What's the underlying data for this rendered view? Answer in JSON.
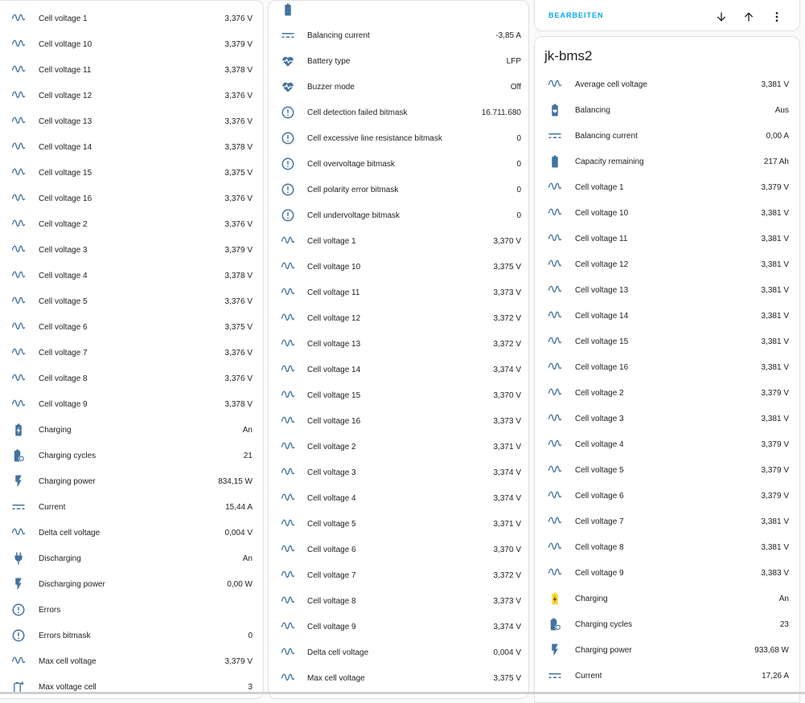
{
  "colors": {
    "icon": "#44739e",
    "charging_active": "#fdd835",
    "accent": "#03a9f4"
  },
  "column1": [
    {
      "icon": "sine-wave-icon",
      "name": "Cell voltage 1",
      "value": "3,376 V"
    },
    {
      "icon": "sine-wave-icon",
      "name": "Cell voltage 10",
      "value": "3,379 V"
    },
    {
      "icon": "sine-wave-icon",
      "name": "Cell voltage 11",
      "value": "3,378 V"
    },
    {
      "icon": "sine-wave-icon",
      "name": "Cell voltage 12",
      "value": "3,376 V"
    },
    {
      "icon": "sine-wave-icon",
      "name": "Cell voltage 13",
      "value": "3,376 V"
    },
    {
      "icon": "sine-wave-icon",
      "name": "Cell voltage 14",
      "value": "3,378 V"
    },
    {
      "icon": "sine-wave-icon",
      "name": "Cell voltage 15",
      "value": "3,375 V"
    },
    {
      "icon": "sine-wave-icon",
      "name": "Cell voltage 16",
      "value": "3,376 V"
    },
    {
      "icon": "sine-wave-icon",
      "name": "Cell voltage 2",
      "value": "3,376 V"
    },
    {
      "icon": "sine-wave-icon",
      "name": "Cell voltage 3",
      "value": "3,379 V"
    },
    {
      "icon": "sine-wave-icon",
      "name": "Cell voltage 4",
      "value": "3,378 V"
    },
    {
      "icon": "sine-wave-icon",
      "name": "Cell voltage 5",
      "value": "3,376 V"
    },
    {
      "icon": "sine-wave-icon",
      "name": "Cell voltage 6",
      "value": "3,375 V"
    },
    {
      "icon": "sine-wave-icon",
      "name": "Cell voltage 7",
      "value": "3,376 V"
    },
    {
      "icon": "sine-wave-icon",
      "name": "Cell voltage 8",
      "value": "3,376 V"
    },
    {
      "icon": "sine-wave-icon",
      "name": "Cell voltage 9",
      "value": "3,378 V"
    },
    {
      "icon": "battery-charging-icon",
      "name": "Charging",
      "value": "An"
    },
    {
      "icon": "battery-sync-icon",
      "name": "Charging cycles",
      "value": "21"
    },
    {
      "icon": "flash-icon",
      "name": "Charging power",
      "value": "834,15 W"
    },
    {
      "icon": "current-dc-icon",
      "name": "Current",
      "value": "15,44 A"
    },
    {
      "icon": "sine-wave-icon",
      "name": "Delta cell voltage",
      "value": "0,004 V"
    },
    {
      "icon": "power-plug-icon",
      "name": "Discharging",
      "value": "An"
    },
    {
      "icon": "flash-icon",
      "name": "Discharging power",
      "value": "0,00 W"
    },
    {
      "icon": "alert-circle-icon",
      "name": "Errors",
      "value": ""
    },
    {
      "icon": "alert-circle-icon",
      "name": "Errors bitmask",
      "value": "0"
    },
    {
      "icon": "sine-wave-icon",
      "name": "Max cell voltage",
      "value": "3,379 V"
    },
    {
      "icon": "battery-plus-icon",
      "name": "Max voltage cell",
      "value": "3"
    }
  ],
  "column2": [
    {
      "icon": "battery-icon",
      "name": "",
      "value": ""
    },
    {
      "icon": "current-dc-icon",
      "name": "Balancing current",
      "value": "-3,85 A"
    },
    {
      "icon": "heart-pulse-icon",
      "name": "Battery type",
      "value": "LFP"
    },
    {
      "icon": "heart-pulse-icon",
      "name": "Buzzer mode",
      "value": "Off"
    },
    {
      "icon": "alert-circle-icon",
      "name": "Cell detection failed bitmask",
      "value": "16.711.680"
    },
    {
      "icon": "alert-circle-icon",
      "name": "Cell excessive line resistance bitmask",
      "value": "0"
    },
    {
      "icon": "alert-circle-icon",
      "name": "Cell overvoltage bitmask",
      "value": "0"
    },
    {
      "icon": "alert-circle-icon",
      "name": "Cell polarity error bitmask",
      "value": "0"
    },
    {
      "icon": "alert-circle-icon",
      "name": "Cell undervoltage bitmask",
      "value": "0"
    },
    {
      "icon": "sine-wave-icon",
      "name": "Cell voltage 1",
      "value": "3,370 V"
    },
    {
      "icon": "sine-wave-icon",
      "name": "Cell voltage 10",
      "value": "3,375 V"
    },
    {
      "icon": "sine-wave-icon",
      "name": "Cell voltage 11",
      "value": "3,373 V"
    },
    {
      "icon": "sine-wave-icon",
      "name": "Cell voltage 12",
      "value": "3,372 V"
    },
    {
      "icon": "sine-wave-icon",
      "name": "Cell voltage 13",
      "value": "3,372 V"
    },
    {
      "icon": "sine-wave-icon",
      "name": "Cell voltage 14",
      "value": "3,374 V"
    },
    {
      "icon": "sine-wave-icon",
      "name": "Cell voltage 15",
      "value": "3,370 V"
    },
    {
      "icon": "sine-wave-icon",
      "name": "Cell voltage 16",
      "value": "3,373 V"
    },
    {
      "icon": "sine-wave-icon",
      "name": "Cell voltage 2",
      "value": "3,371 V"
    },
    {
      "icon": "sine-wave-icon",
      "name": "Cell voltage 3",
      "value": "3,374 V"
    },
    {
      "icon": "sine-wave-icon",
      "name": "Cell voltage 4",
      "value": "3,374 V"
    },
    {
      "icon": "sine-wave-icon",
      "name": "Cell voltage 5",
      "value": "3,371 V"
    },
    {
      "icon": "sine-wave-icon",
      "name": "Cell voltage 6",
      "value": "3,370 V"
    },
    {
      "icon": "sine-wave-icon",
      "name": "Cell voltage 7",
      "value": "3,372 V"
    },
    {
      "icon": "sine-wave-icon",
      "name": "Cell voltage 8",
      "value": "3,373 V"
    },
    {
      "icon": "sine-wave-icon",
      "name": "Cell voltage 9",
      "value": "3,374 V"
    },
    {
      "icon": "sine-wave-icon",
      "name": "Delta cell voltage",
      "value": "0,004 V"
    },
    {
      "icon": "sine-wave-icon",
      "name": "Max cell voltage",
      "value": "3,375 V"
    },
    {
      "icon": "battery-plus-icon",
      "name": "Max voltage cell",
      "value": "9"
    }
  ],
  "column3_header": {
    "edit_label": "BEARBEITEN"
  },
  "card3": {
    "title": "jk-bms2",
    "rows": [
      {
        "icon": "sine-wave-icon",
        "name": "Average cell voltage",
        "value": "3,381 V"
      },
      {
        "icon": "battery-heart-icon",
        "name": "Balancing",
        "value": "Aus"
      },
      {
        "icon": "current-dc-icon",
        "name": "Balancing current",
        "value": "0,00 A"
      },
      {
        "icon": "battery-icon",
        "name": "Capacity remaining",
        "value": "217 Ah"
      },
      {
        "icon": "sine-wave-icon",
        "name": "Cell voltage 1",
        "value": "3,379 V"
      },
      {
        "icon": "sine-wave-icon",
        "name": "Cell voltage 10",
        "value": "3,381 V"
      },
      {
        "icon": "sine-wave-icon",
        "name": "Cell voltage 11",
        "value": "3,381 V"
      },
      {
        "icon": "sine-wave-icon",
        "name": "Cell voltage 12",
        "value": "3,381 V"
      },
      {
        "icon": "sine-wave-icon",
        "name": "Cell voltage 13",
        "value": "3,381 V"
      },
      {
        "icon": "sine-wave-icon",
        "name": "Cell voltage 14",
        "value": "3,381 V"
      },
      {
        "icon": "sine-wave-icon",
        "name": "Cell voltage 15",
        "value": "3,381 V"
      },
      {
        "icon": "sine-wave-icon",
        "name": "Cell voltage 16",
        "value": "3,381 V"
      },
      {
        "icon": "sine-wave-icon",
        "name": "Cell voltage 2",
        "value": "3,379 V"
      },
      {
        "icon": "sine-wave-icon",
        "name": "Cell voltage 3",
        "value": "3,381 V"
      },
      {
        "icon": "sine-wave-icon",
        "name": "Cell voltage 4",
        "value": "3,379 V"
      },
      {
        "icon": "sine-wave-icon",
        "name": "Cell voltage 5",
        "value": "3,379 V"
      },
      {
        "icon": "sine-wave-icon",
        "name": "Cell voltage 6",
        "value": "3,379 V"
      },
      {
        "icon": "sine-wave-icon",
        "name": "Cell voltage 7",
        "value": "3,381 V"
      },
      {
        "icon": "sine-wave-icon",
        "name": "Cell voltage 8",
        "value": "3,381 V"
      },
      {
        "icon": "sine-wave-icon",
        "name": "Cell voltage 9",
        "value": "3,383 V"
      },
      {
        "icon": "battery-charging-yellow-icon",
        "name": "Charging",
        "value": "An"
      },
      {
        "icon": "battery-sync-icon",
        "name": "Charging cycles",
        "value": "23"
      },
      {
        "icon": "flash-icon",
        "name": "Charging power",
        "value": "933,68 W"
      },
      {
        "icon": "current-dc-icon",
        "name": "Current",
        "value": "17,26 A"
      }
    ]
  }
}
